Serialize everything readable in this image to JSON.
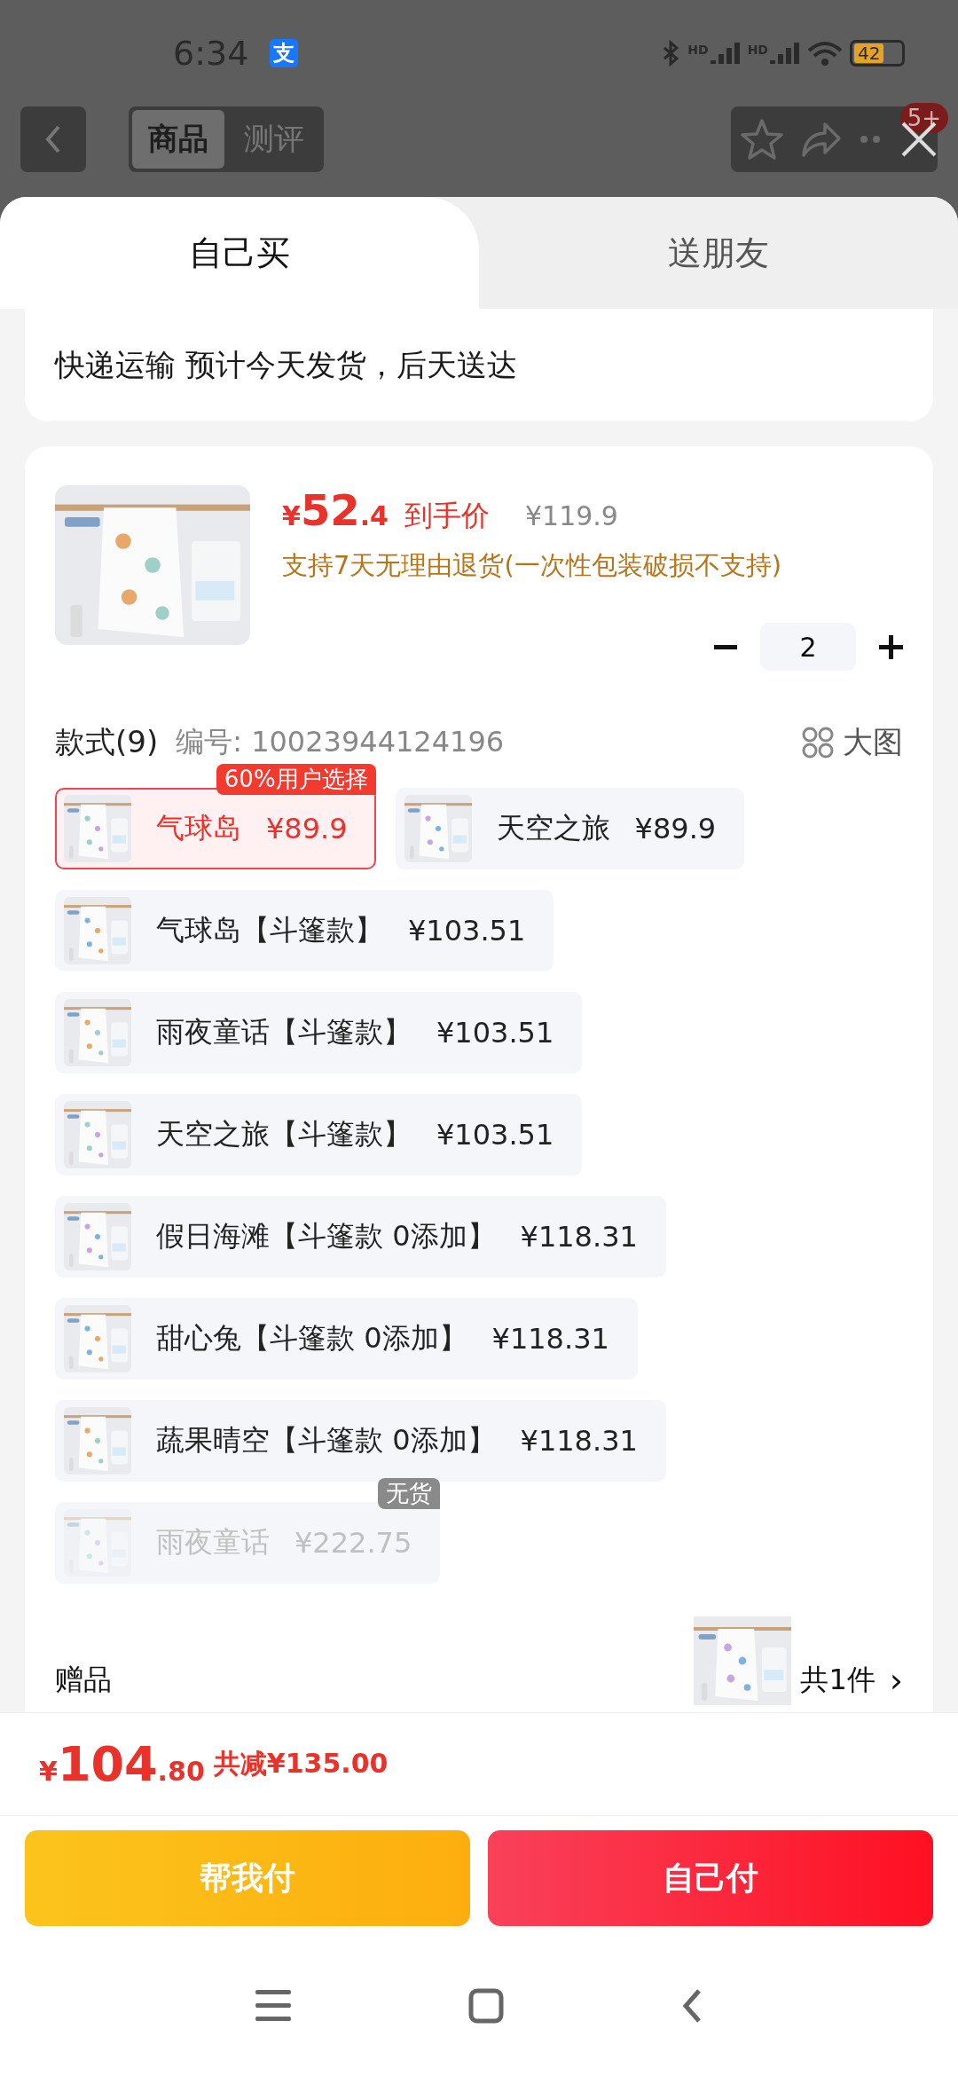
{
  "status_bar": {
    "time": "6:34",
    "app_badge": "支",
    "signals": [
      "HD",
      "HD"
    ],
    "battery": "42"
  },
  "header": {
    "tabs": [
      {
        "label": "商品",
        "selected": true
      },
      {
        "label": "测评",
        "selected": false
      }
    ],
    "badge": "5+"
  },
  "sheet_tabs": [
    {
      "label": "自己买",
      "selected": true
    },
    {
      "label": "送朋友",
      "selected": false
    }
  ],
  "delivery": "快递运输 预计今天发货，后天送达",
  "product": {
    "price": {
      "currency": "¥",
      "integer": "52",
      "decimal": ".4"
    },
    "price_label": "到手价",
    "original_price": "¥119.9",
    "return_policy": "支持7天无理由退货(一次性包装破损不支持)",
    "quantity": "2"
  },
  "styles": {
    "title": "款式(9)",
    "code": "编号: 10023944124196",
    "view_toggle": "大图",
    "rows": [
      [
        {
          "name": "气球岛",
          "price": "¥89.9",
          "selected": true,
          "available": true,
          "tag": "60%用户选择"
        },
        {
          "name": "天空之旅",
          "price": "¥89.9",
          "selected": false,
          "available": true
        }
      ],
      [
        {
          "name": "气球岛【斗篷款】",
          "price": "¥103.51",
          "selected": false,
          "available": true
        }
      ],
      [
        {
          "name": "雨夜童话【斗篷款】",
          "price": "¥103.51",
          "selected": false,
          "available": true
        }
      ],
      [
        {
          "name": "天空之旅【斗篷款】",
          "price": "¥103.51",
          "selected": false,
          "available": true
        }
      ],
      [
        {
          "name": "假日海滩【斗篷款 0添加】",
          "price": "¥118.31",
          "selected": false,
          "available": true
        }
      ],
      [
        {
          "name": "甜心兔【斗篷款 0添加】",
          "price": "¥118.31",
          "selected": false,
          "available": true
        }
      ],
      [
        {
          "name": "蔬果晴空【斗篷款 0添加】",
          "price": "¥118.31",
          "selected": false,
          "available": true
        }
      ],
      [
        {
          "name": "雨夜童话",
          "price": "¥222.75",
          "selected": false,
          "available": false,
          "tag": "无货"
        }
      ]
    ]
  },
  "gift": {
    "label": "赠品",
    "count": "共1件",
    "chevron": "›"
  },
  "total": {
    "currency": "¥",
    "integer": "104",
    "decimal": ".80",
    "discount": "共减¥135.00"
  },
  "buttons": [
    {
      "label": "帮我付",
      "kind": "secondary"
    },
    {
      "label": "自己付",
      "kind": "primary"
    }
  ]
}
